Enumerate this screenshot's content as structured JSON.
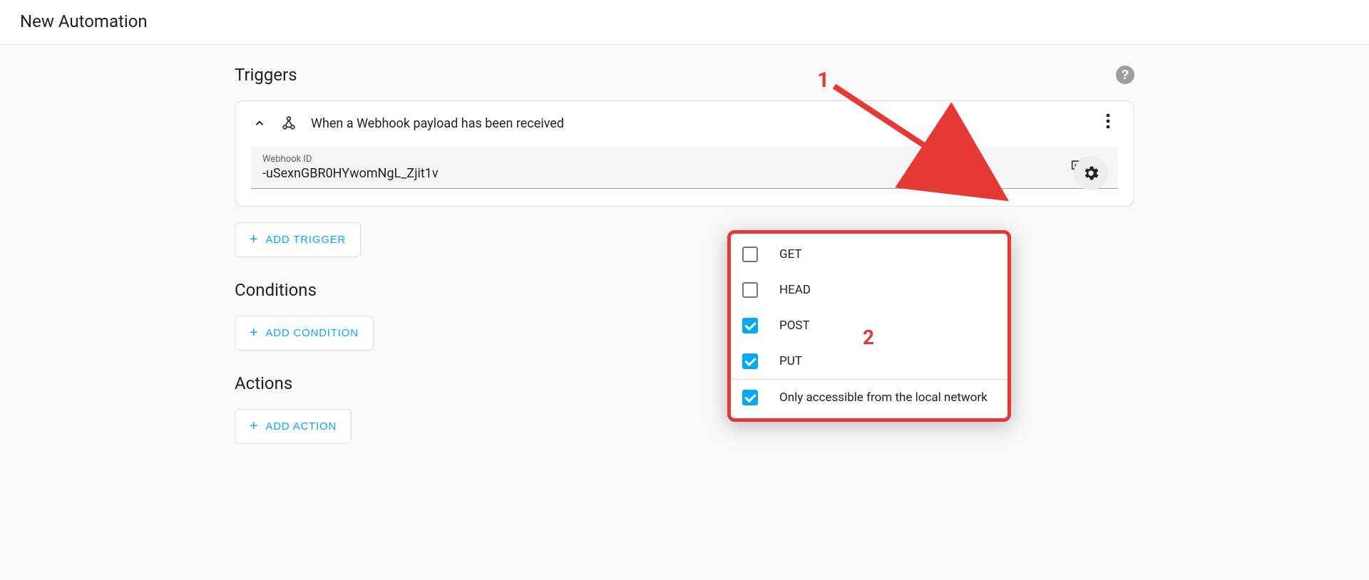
{
  "page_title": "New Automation",
  "triggers": {
    "section_title": "Triggers",
    "card_title": "When a Webhook payload has been received",
    "webhook_id_label": "Webhook ID",
    "webhook_id_value": "-uSexnGBR0HYwomNgL_Zjit1v",
    "add_button": "ADD TRIGGER"
  },
  "conditions": {
    "section_title": "Conditions",
    "add_button": "ADD CONDITION"
  },
  "actions": {
    "section_title": "Actions",
    "add_button": "ADD ACTION"
  },
  "popup": {
    "items": [
      {
        "label": "GET",
        "checked": false
      },
      {
        "label": "HEAD",
        "checked": false
      },
      {
        "label": "POST",
        "checked": true
      },
      {
        "label": "PUT",
        "checked": true
      },
      {
        "label": "Only accessible from the local network",
        "checked": true,
        "separator": true
      }
    ]
  },
  "annotations": {
    "one": "1",
    "two": "2"
  },
  "colors": {
    "accent": "#03a9f4",
    "annotation": "#e53935"
  }
}
